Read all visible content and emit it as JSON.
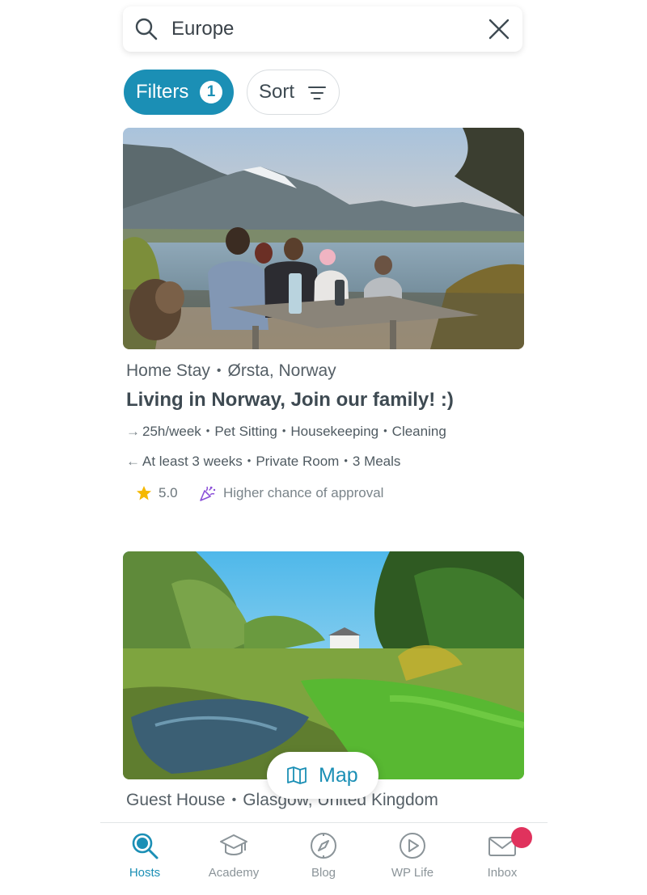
{
  "search": {
    "value": "Europe"
  },
  "filters": {
    "label": "Filters",
    "count": "1"
  },
  "sort": {
    "label": "Sort"
  },
  "listings": [
    {
      "type": "Home Stay",
      "location": "Ørsta, Norway",
      "title": "Living in Norway, Join our family! :)",
      "hours": "25h/week",
      "help": [
        "Pet Sitting",
        "Housekeeping",
        "Cleaning"
      ],
      "stay": "At least 3 weeks",
      "benefits": [
        "Private Room",
        "3 Meals"
      ],
      "rating": "5.0",
      "approval": "Higher chance of approval"
    },
    {
      "type": "Guest House",
      "location": "Glasgow, United Kingdom"
    }
  ],
  "map_button": {
    "label": "Map"
  },
  "nav": {
    "items": [
      {
        "label": "Hosts",
        "icon": "hosts-search-icon",
        "active": true
      },
      {
        "label": "Academy",
        "icon": "graduation-cap-icon"
      },
      {
        "label": "Blog",
        "icon": "compass-icon"
      },
      {
        "label": "WP Life",
        "icon": "play-icon"
      },
      {
        "label": "Inbox",
        "icon": "envelope-icon",
        "has_notification": true
      }
    ]
  },
  "colors": {
    "accent": "#1b8fb5",
    "badge": "#e0325d",
    "star": "#f5b800",
    "confetti": "#8a4fd8"
  }
}
